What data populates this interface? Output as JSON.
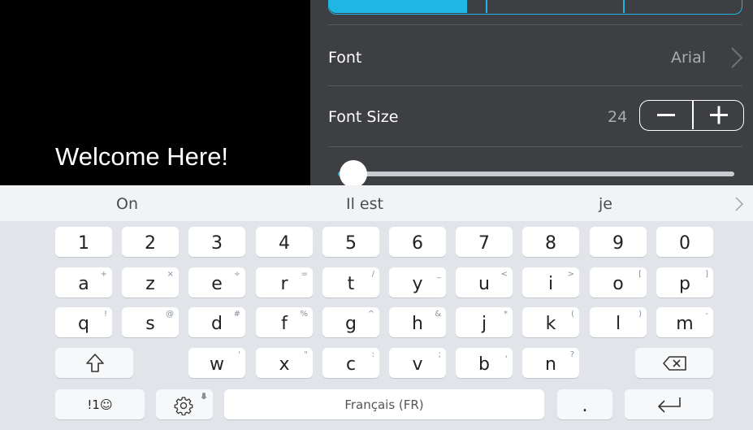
{
  "preview": {
    "text": "Welcome Here!"
  },
  "settings": {
    "font_label": "Font",
    "font_value": "Arial",
    "font_size_label": "Font Size",
    "font_size_value": "24",
    "minus_symbol": "—",
    "plus_symbol": "+",
    "slider_level": 0.03,
    "accent_color": "#1fb6e6"
  },
  "suggestions": {
    "items": [
      "On",
      "Il est",
      "je"
    ],
    "more_icon": "chevron-right-icon"
  },
  "keyboard": {
    "number_row": [
      "1",
      "2",
      "3",
      "4",
      "5",
      "6",
      "7",
      "8",
      "9",
      "0"
    ],
    "row1": [
      {
        "main": "a",
        "sub": "+"
      },
      {
        "main": "z",
        "sub": "×"
      },
      {
        "main": "e",
        "sub": "÷"
      },
      {
        "main": "r",
        "sub": "="
      },
      {
        "main": "t",
        "sub": "/"
      },
      {
        "main": "y",
        "sub": "_"
      },
      {
        "main": "u",
        "sub": "<"
      },
      {
        "main": "i",
        "sub": ">"
      },
      {
        "main": "o",
        "sub": "["
      },
      {
        "main": "p",
        "sub": "]"
      }
    ],
    "row2": [
      {
        "main": "q",
        "sub": "!"
      },
      {
        "main": "s",
        "sub": "@"
      },
      {
        "main": "d",
        "sub": "#"
      },
      {
        "main": "f",
        "sub": "%"
      },
      {
        "main": "g",
        "sub": "^"
      },
      {
        "main": "h",
        "sub": "&"
      },
      {
        "main": "j",
        "sub": "*"
      },
      {
        "main": "k",
        "sub": "("
      },
      {
        "main": "l",
        "sub": ")"
      },
      {
        "main": "m",
        "sub": "-"
      }
    ],
    "row3": [
      {
        "main": "w",
        "sub": "'"
      },
      {
        "main": "x",
        "sub": "\""
      },
      {
        "main": "c",
        "sub": ":"
      },
      {
        "main": "v",
        "sub": ";"
      },
      {
        "main": "b",
        "sub": ","
      },
      {
        "main": "n",
        "sub": "?"
      }
    ],
    "symbols_label": "!1☺",
    "space_label": "Français (FR)",
    "period_label": ".",
    "icons": {
      "shift": "shift-arrow-icon",
      "backspace": "backspace-icon",
      "settings": "gear-icon",
      "enter": "enter-icon",
      "mic": "microphone-icon"
    }
  }
}
